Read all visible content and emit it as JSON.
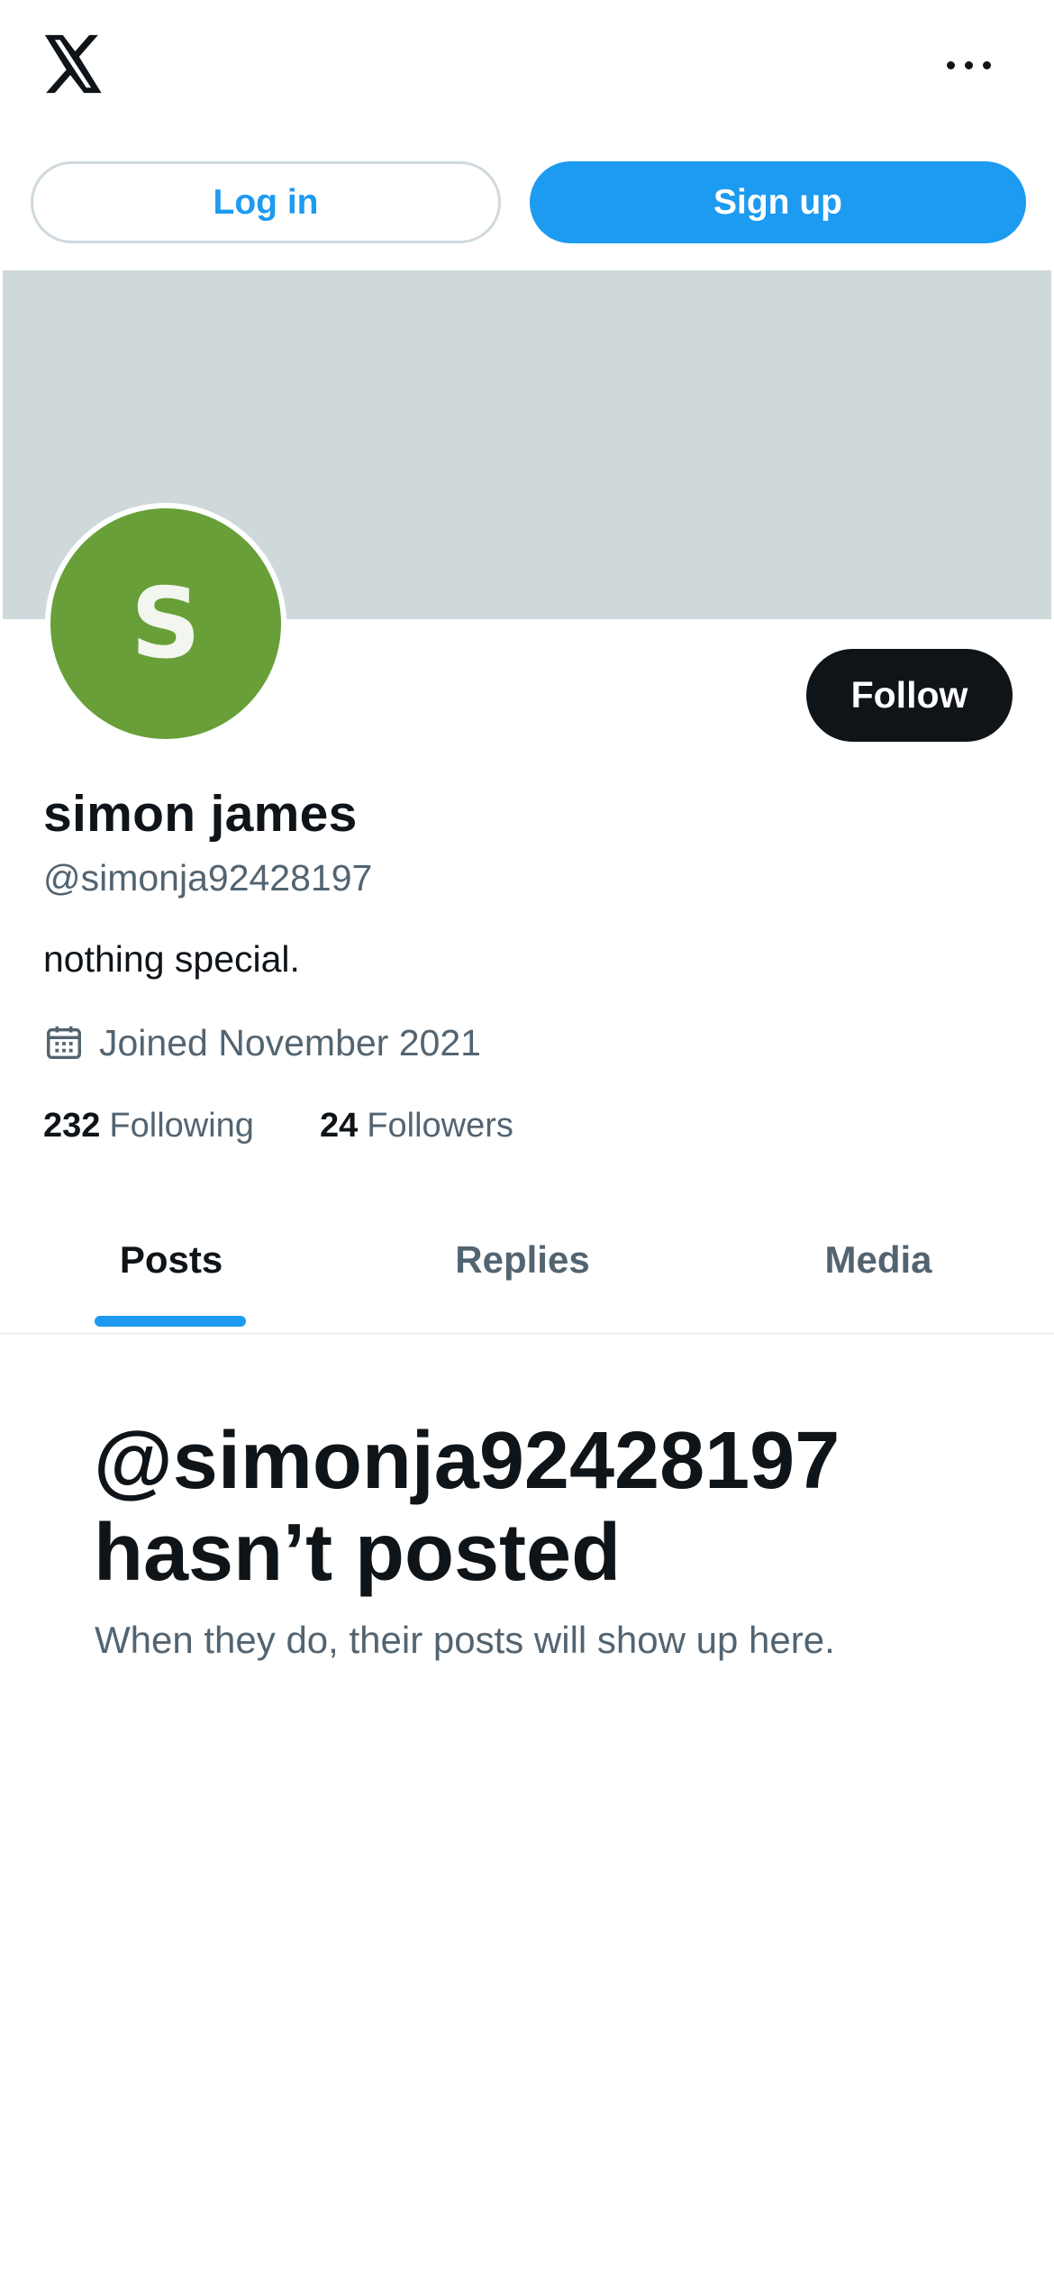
{
  "header": {
    "logo_icon": "x-logo-icon",
    "more_icon": "more-options-icon"
  },
  "auth": {
    "login_label": "Log in",
    "signup_label": "Sign up"
  },
  "profile": {
    "avatar_letter": "S",
    "avatar_color": "#689f38",
    "banner_color": "#cfd9dc",
    "follow_label": "Follow",
    "display_name": "simon james",
    "handle": "@simonja92428197",
    "bio": "nothing special.",
    "joined_icon": "calendar-icon",
    "joined": "Joined November 2021",
    "following_count": "232",
    "following_label": "Following",
    "followers_count": "24",
    "followers_label": "Followers"
  },
  "tabs": [
    {
      "label": "Posts",
      "active": true
    },
    {
      "label": "Replies",
      "active": false
    },
    {
      "label": "Media",
      "active": false
    }
  ],
  "empty_state": {
    "title_line1": "@simonja92428197",
    "title_line2": "hasn’t posted",
    "subtitle": "When they do, their posts will show up here."
  },
  "colors": {
    "accent": "#1d9bf0",
    "text_primary": "#0f1419",
    "text_secondary": "#536471"
  }
}
